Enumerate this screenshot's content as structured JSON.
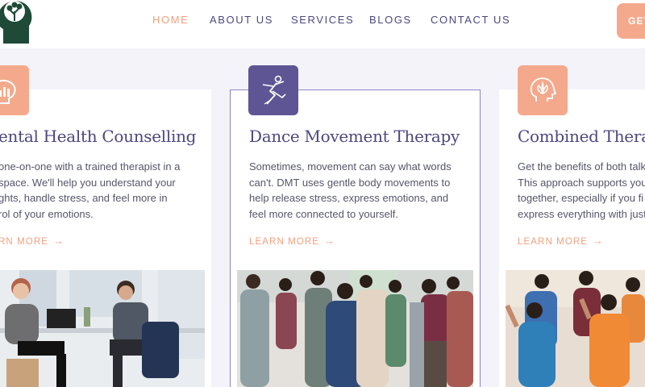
{
  "nav": {
    "items": [
      {
        "label": "HOME",
        "active": true
      },
      {
        "label": "ABOUT US",
        "active": false
      },
      {
        "label": "SERVICES",
        "active": false
      },
      {
        "label": "BLOGS",
        "active": false
      },
      {
        "label": "CONTACT US",
        "active": false
      }
    ],
    "cta_label": "GET"
  },
  "cards": [
    {
      "title": "ental Health Counselling",
      "lines": [
        "one-on-one with a trained therapist in a",
        "space. We'll help you understand your",
        "ghts, handle stress, and feel more in",
        "rol of your emotions."
      ],
      "learn_more": "RN MORE",
      "icon": "brain-chart-icon"
    },
    {
      "title": "Dance Movement Therapy",
      "lines": [
        "Sometimes, movement can say what words",
        "can't. DMT uses gentle body movements to",
        "help release stress, express emotions, and",
        "feel more connected to yourself."
      ],
      "learn_more": "LEARN MORE",
      "icon": "dancer-icon"
    },
    {
      "title": "Combined Therap",
      "lines": [
        "Get the benefits of both talk",
        "This approach supports you",
        "together, especially if you fi",
        "express everything with just"
      ],
      "learn_more": "LEARN MORE",
      "icon": "head-lotus-icon"
    }
  ],
  "colors": {
    "accent": "#f0a07e",
    "primary": "#4d4680",
    "icon_bg_peach": "#f4a98c",
    "icon_bg_purple": "#5e5594"
  }
}
